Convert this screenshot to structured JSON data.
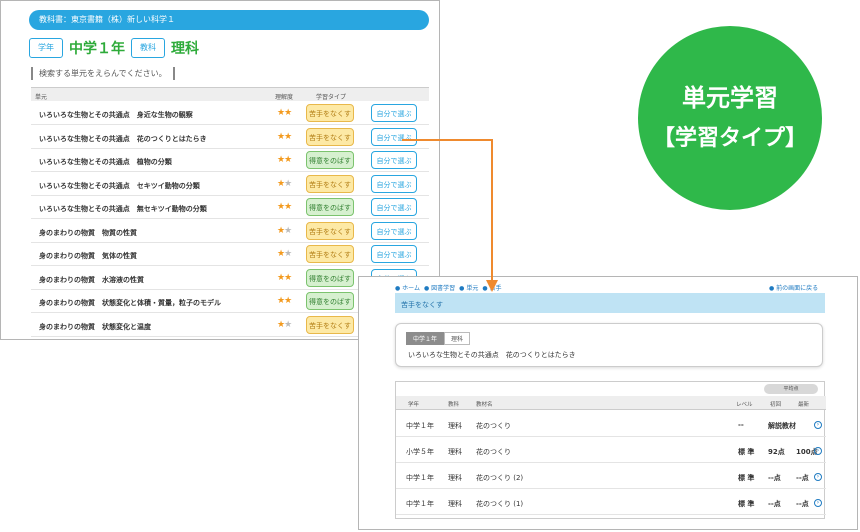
{
  "left": {
    "textbook": "教科書：東京書籍（株）新しい科学１",
    "grade_label": "学年",
    "grade_value": "中学１年",
    "subject_label": "教科",
    "subject_value": "理科",
    "instruction": "検索する単元をえらんでください。",
    "headers": {
      "unit": "単元",
      "level": "理解度",
      "type": "学習タイプ"
    },
    "rows": [
      {
        "title": "いろいろな生物とその共通点　身近な生物の観察",
        "stars": 2,
        "type": "苦手をなくす",
        "kind": "weak",
        "self": "自分で選ぶ"
      },
      {
        "title": "いろいろな生物とその共通点　花のつくりとはたらき",
        "stars": 2,
        "type": "苦手をなくす",
        "kind": "weak",
        "self": "自分で選ぶ"
      },
      {
        "title": "いろいろな生物とその共通点　植物の分類",
        "stars": 2,
        "type": "得意をのばす",
        "kind": "strong",
        "self": "自分で選ぶ"
      },
      {
        "title": "いろいろな生物とその共通点　セキツイ動物の分類",
        "stars": 1,
        "type": "苦手をなくす",
        "kind": "weak",
        "self": "自分で選ぶ"
      },
      {
        "title": "いろいろな生物とその共通点　無セキツイ動物の分類",
        "stars": 2,
        "type": "得意をのばす",
        "kind": "strong",
        "self": "自分で選ぶ"
      },
      {
        "title": "身のまわりの物質　物質の性質",
        "stars": 1,
        "type": "苦手をなくす",
        "kind": "weak",
        "self": "自分で選ぶ"
      },
      {
        "title": "身のまわりの物質　気体の性質",
        "stars": 1,
        "type": "苦手をなくす",
        "kind": "weak",
        "self": "自分で選ぶ"
      },
      {
        "title": "身のまわりの物質　水溶液の性質",
        "stars": 2,
        "type": "得意をのばす",
        "kind": "strong",
        "self": "自分で選ぶ"
      },
      {
        "title": "身のまわりの物質　状態変化と体積・質量，粒子のモデル",
        "stars": 2,
        "type": "得意をのばす",
        "kind": "strong",
        "self": "自分で選ぶ"
      },
      {
        "title": "身のまわりの物質　状態変化と温度",
        "stars": 1,
        "type": "苦手をなくす",
        "kind": "weak",
        "self": "自分で選ぶ"
      }
    ]
  },
  "badge": {
    "line1": "単元学習",
    "line2": "【学習タイプ】"
  },
  "right": {
    "nav": [
      "ホーム",
      "図書学習",
      "単元",
      "苦手"
    ],
    "back": "前の画面に戻る",
    "type_title": "苦手をなくす",
    "info_tags": [
      "中学１年",
      "理科"
    ],
    "info_title": "いろいろな生物とその共通点　花のつくりとはたらき",
    "avg_label": "平均点",
    "headers": {
      "grade": "学年",
      "subject": "教科",
      "material": "教材名",
      "level": "レベル",
      "first": "初回",
      "latest": "最新"
    },
    "rows": [
      {
        "grade": "中学１年",
        "subject": "理科",
        "material": "花のつくり",
        "level": "--",
        "first": "解説教材",
        "latest": ""
      },
      {
        "grade": "小学５年",
        "subject": "理科",
        "material": "花のつくり",
        "level": "標 準",
        "first": "92点",
        "latest": "100点"
      },
      {
        "grade": "中学１年",
        "subject": "理科",
        "material": "花のつくり (2)",
        "level": "標 準",
        "first": "--点",
        "latest": "--点"
      },
      {
        "grade": "中学１年",
        "subject": "理科",
        "material": "花のつくり (1)",
        "level": "標 準",
        "first": "--点",
        "latest": "--点"
      }
    ]
  },
  "colors": {
    "blue": "#29a6e0",
    "green": "#2fb84a",
    "orange": "#ef8a2e"
  }
}
